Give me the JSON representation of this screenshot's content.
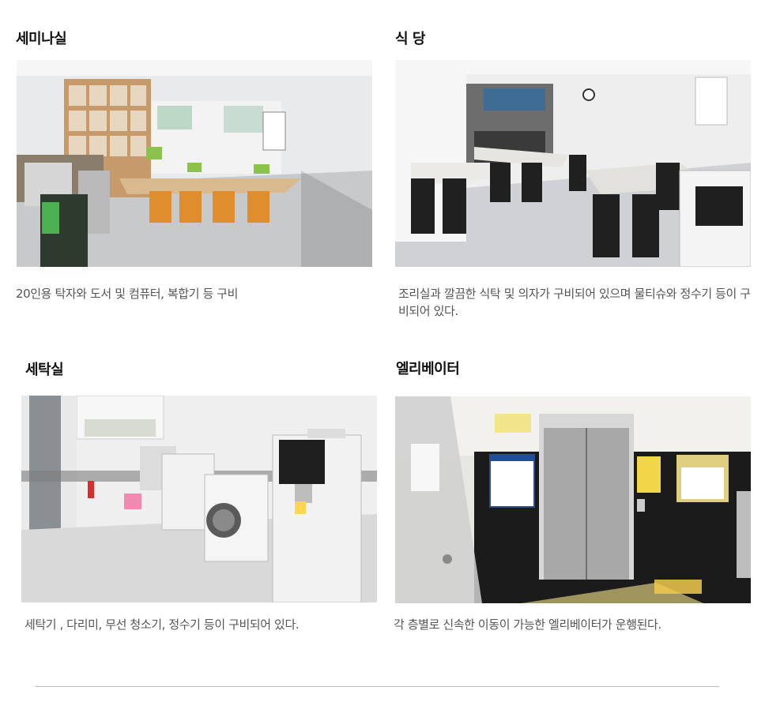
{
  "facilities": [
    {
      "title": "세미나실",
      "photo_icon": "seminar-room-photo",
      "description": "20인용 탁자와 도서 및 컴퓨터, 복합기 등 구비"
    },
    {
      "title": "식 당",
      "photo_icon": "cafeteria-photo",
      "description": "조리실과 깔끔한 식탁 및 의자가 구비되어 있으며 물티슈와 정수기 등이 구비되어 있다."
    },
    {
      "title": "세탁실",
      "photo_icon": "laundry-room-photo",
      "description": "세탁기 , 다리미, 무선 청소기, 정수기 등이 구비되어  있다."
    },
    {
      "title": "엘리베이터",
      "photo_icon": "elevator-photo",
      "description": "각 층별로 신속한 이동이 가능한 엘리베이터가 운행된다."
    }
  ]
}
